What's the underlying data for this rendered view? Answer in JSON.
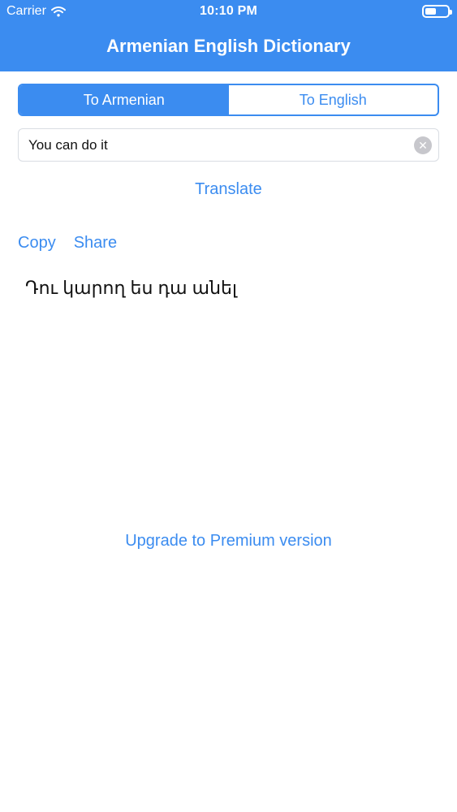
{
  "status_bar": {
    "carrier": "Carrier",
    "time": "10:10 PM",
    "battery_level": 0.5,
    "icons": {
      "wifi": "wifi-icon",
      "battery": "battery-icon"
    }
  },
  "header": {
    "title": "Armenian English Dictionary",
    "color": "#3b8cf0"
  },
  "segmented_control": {
    "options": [
      {
        "label": "To Armenian",
        "selected": true
      },
      {
        "label": "To English",
        "selected": false
      }
    ]
  },
  "search": {
    "value": "You can do it",
    "clear_icon": "clear-icon",
    "clear_glyph": "✕"
  },
  "buttons": {
    "translate": "Translate",
    "copy": "Copy",
    "share": "Share",
    "upgrade": "Upgrade to Premium version"
  },
  "output": {
    "text": "Դու կարող ես դա անել"
  },
  "colors": {
    "accent": "#3b8cf0",
    "text": "#111111",
    "border": "#d9dde3"
  }
}
